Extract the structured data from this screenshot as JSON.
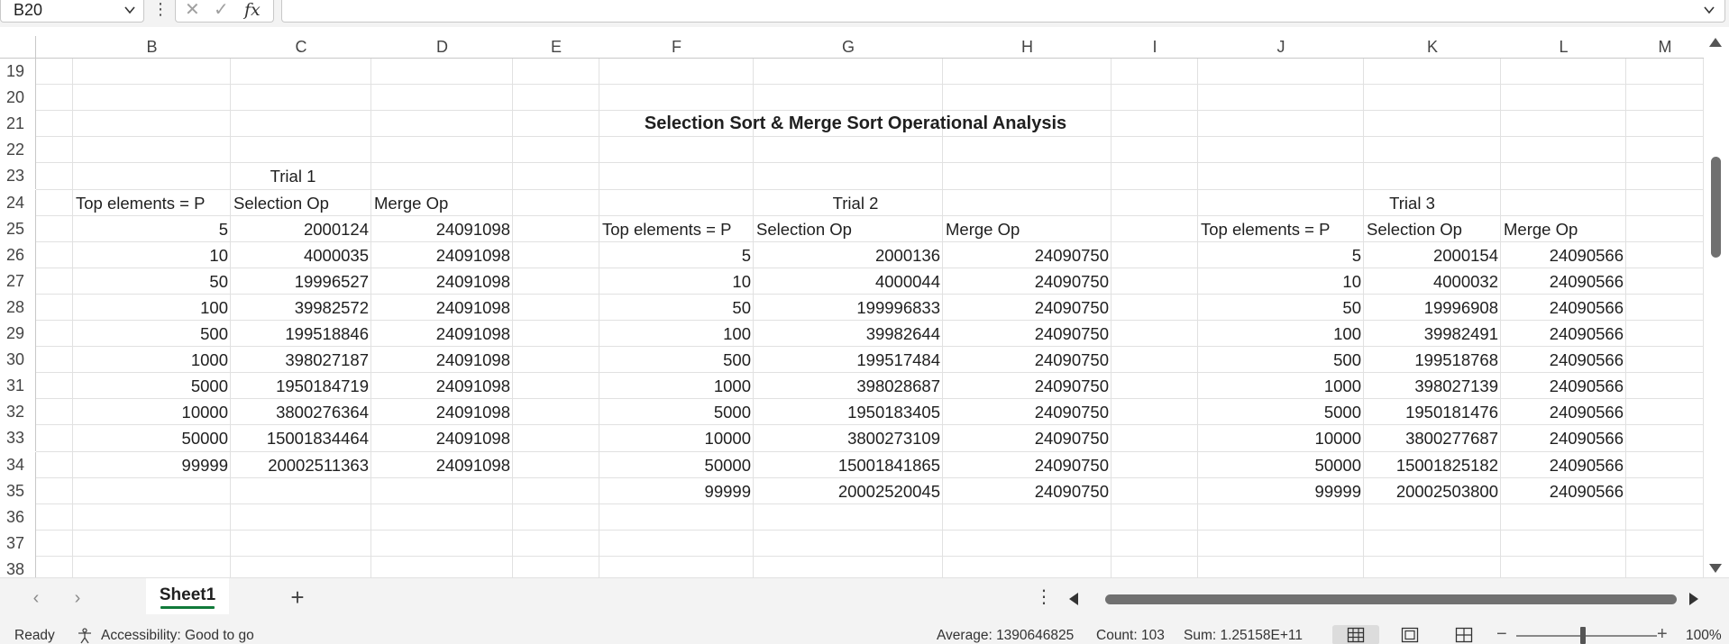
{
  "formula_bar": {
    "name_box": "B20",
    "more_icon": "⋮",
    "cancel_icon": "✕",
    "enter_icon": "✓",
    "function_icon": "fx",
    "formula": ""
  },
  "columns": [
    "B",
    "C",
    "D",
    "E",
    "F",
    "G",
    "H",
    "I",
    "J",
    "K",
    "L",
    "M"
  ],
  "rows": [
    "19",
    "20",
    "21",
    "22",
    "23",
    "24",
    "25",
    "26",
    "27",
    "28",
    "29",
    "30",
    "31",
    "32",
    "33",
    "34",
    "35",
    "36",
    "37",
    "38"
  ],
  "sheet": {
    "title": "Selection Sort & Merge Sort Operational Analysis",
    "trial1": {
      "label": "Trial 1",
      "headers": [
        "Top elements = P",
        "Selection Op",
        "Merge Op"
      ],
      "rows": [
        [
          "5",
          "2000124",
          "24091098"
        ],
        [
          "10",
          "4000035",
          "24091098"
        ],
        [
          "50",
          "19996527",
          "24091098"
        ],
        [
          "100",
          "39982572",
          "24091098"
        ],
        [
          "500",
          "199518846",
          "24091098"
        ],
        [
          "1000",
          "398027187",
          "24091098"
        ],
        [
          "5000",
          "1950184719",
          "24091098"
        ],
        [
          "10000",
          "3800276364",
          "24091098"
        ],
        [
          "50000",
          "15001834464",
          "24091098"
        ],
        [
          "99999",
          "20002511363",
          "24091098"
        ]
      ]
    },
    "trial2": {
      "label": "Trial 2",
      "headers": [
        "Top elements = P",
        "Selection Op",
        "Merge Op"
      ],
      "rows": [
        [
          "5",
          "2000136",
          "24090750"
        ],
        [
          "10",
          "4000044",
          "24090750"
        ],
        [
          "50",
          "199996833",
          "24090750"
        ],
        [
          "100",
          "39982644",
          "24090750"
        ],
        [
          "500",
          "199517484",
          "24090750"
        ],
        [
          "1000",
          "398028687",
          "24090750"
        ],
        [
          "5000",
          "1950183405",
          "24090750"
        ],
        [
          "10000",
          "3800273109",
          "24090750"
        ],
        [
          "50000",
          "15001841865",
          "24090750"
        ],
        [
          "99999",
          "20002520045",
          "24090750"
        ]
      ]
    },
    "trial3": {
      "label": "Trial 3",
      "headers": [
        "Top elements = P",
        "Selection Op",
        "Merge Op"
      ],
      "rows": [
        [
          "5",
          "2000154",
          "24090566"
        ],
        [
          "10",
          "4000032",
          "24090566"
        ],
        [
          "50",
          "19996908",
          "24090566"
        ],
        [
          "100",
          "39982491",
          "24090566"
        ],
        [
          "500",
          "199518768",
          "24090566"
        ],
        [
          "1000",
          "398027139",
          "24090566"
        ],
        [
          "5000",
          "1950181476",
          "24090566"
        ],
        [
          "10000",
          "3800277687",
          "24090566"
        ],
        [
          "50000",
          "15001825182",
          "24090566"
        ],
        [
          "99999",
          "20002503800",
          "24090566"
        ]
      ]
    }
  },
  "tabs": {
    "sheet_name": "Sheet1",
    "prev_icon": "‹",
    "next_icon": "›",
    "add_icon": "+",
    "more_icon": "⋮"
  },
  "status_bar": {
    "ready": "Ready",
    "accessibility": "Accessibility: Good to go",
    "average": "Average: 1390646825",
    "count": "Count: 103",
    "sum": "Sum: 1.25158E+11",
    "zoom_minus": "−",
    "zoom_plus": "+",
    "zoom": "100%"
  },
  "colors": {
    "accent_green": "#117a3a",
    "gridline": "#e1e1e1",
    "chrome": "#f3f3f3"
  }
}
